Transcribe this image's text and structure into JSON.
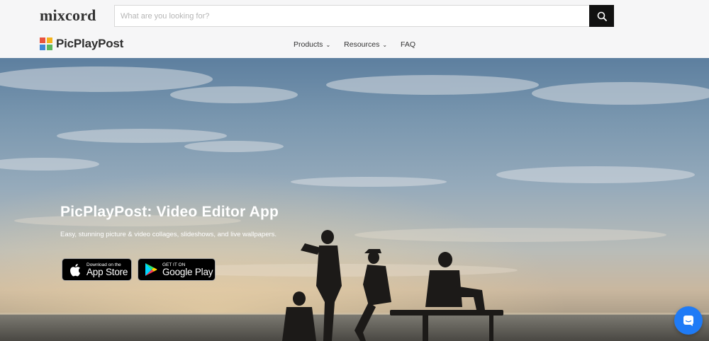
{
  "header": {
    "site_logo": "mixcord",
    "search": {
      "placeholder": "What are you looking for?",
      "value": ""
    },
    "brand": "PicPlayPost",
    "nav": [
      {
        "label": "Products",
        "has_dropdown": true
      },
      {
        "label": "Resources",
        "has_dropdown": true
      },
      {
        "label": "FAQ",
        "has_dropdown": false
      }
    ]
  },
  "hero": {
    "title": "PicPlayPost: Video Editor App",
    "subtitle": "Easy, stunning picture & video collages, slideshows, and live wallpapers.",
    "app_store": {
      "small": "Download on the",
      "big": "App Store"
    },
    "google_play": {
      "small": "GET IT ON",
      "big": "Google Play"
    }
  },
  "icons": {
    "search": "search-icon",
    "apple": "apple-icon",
    "play": "google-play-icon",
    "chat": "chat-icon"
  },
  "colors": {
    "accent_chat": "#1f7bf6",
    "search_button": "#111111"
  }
}
